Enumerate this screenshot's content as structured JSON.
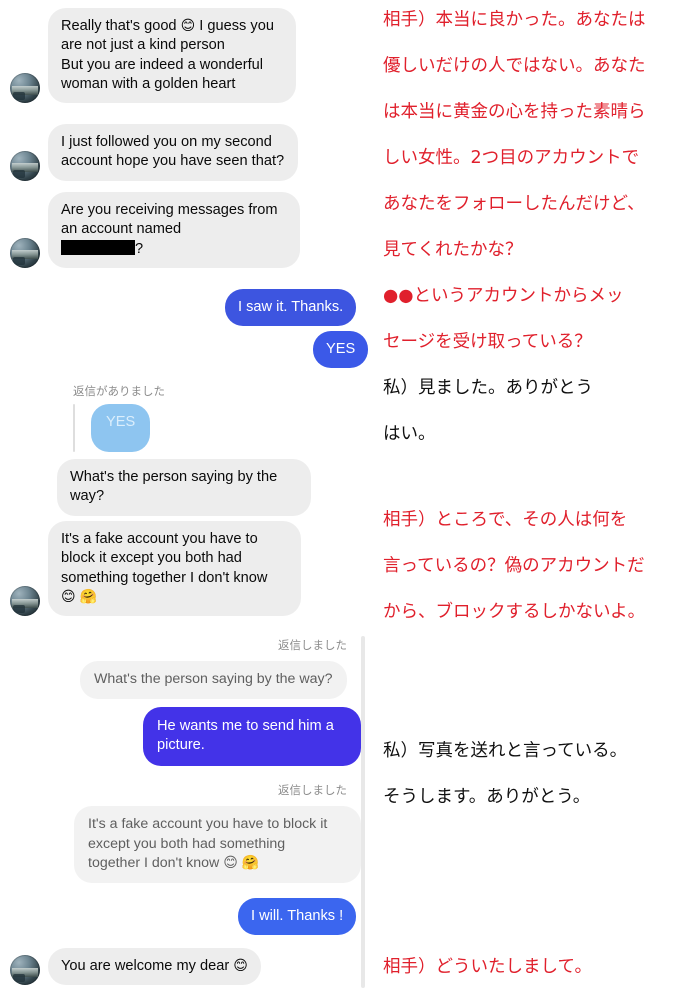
{
  "app": {
    "title": "Messenger conversation with Japanese translation",
    "accent_blue": "#3d55e0",
    "accent_indigo": "#4333e8",
    "bubble_gray": "#ededed",
    "translation_red": "#e0202c",
    "translation_black": "#101010"
  },
  "chat": {
    "messages": [
      {
        "id": "msg-1",
        "sender": "them",
        "text": "Really that's good 😊 I guess you are not just a kind person\nBut you are indeed a wonderful woman with a golden heart",
        "line1": "Really that's good",
        "emoji": "😊",
        "line1b": "I guess you",
        "line2": "are not just a kind person",
        "line3": "But you are indeed a wonderful",
        "line4": "woman with a golden heart",
        "has_avatar": true
      },
      {
        "id": "msg-2",
        "sender": "them",
        "text": "I just followed you on my second account hope you have seen that?",
        "has_avatar": true
      },
      {
        "id": "msg-3",
        "sender": "them",
        "text": "Are you receiving messages from an account named",
        "redacted": true,
        "trailing": "?",
        "has_avatar": true
      },
      {
        "id": "msg-4",
        "sender": "me",
        "text": "I saw it. Thanks."
      },
      {
        "id": "msg-5",
        "sender": "me",
        "text": "YES"
      },
      {
        "id": "reply-1",
        "type": "reply-notice",
        "label": "返信がありました",
        "quoted_text": "YES"
      },
      {
        "id": "msg-6",
        "sender": "them",
        "text": "What's the person saying by the way?"
      },
      {
        "id": "msg-7",
        "sender": "them",
        "line1": "It's a fake account you have to",
        "line2": "block it except you both had",
        "line3": "something together I don't know",
        "emoji1": "😊",
        "emoji2": "🤗",
        "has_avatar": true
      },
      {
        "id": "reply-2",
        "type": "reply-sent",
        "label": "返信しました",
        "quoted_text": "What's the person saying by the way?"
      },
      {
        "id": "msg-8",
        "sender": "me",
        "text": "He wants me to send him a picture."
      },
      {
        "id": "reply-3",
        "type": "reply-sent",
        "label": "返信しました",
        "q_line1": "It's a fake account you have to block it",
        "q_line2": "except you both had something",
        "q_line3": "together I don't know",
        "q_emoji1": "😊",
        "q_emoji2": "🤗"
      },
      {
        "id": "msg-9",
        "sender": "me",
        "text": "I will. Thanks !"
      },
      {
        "id": "msg-10",
        "sender": "them",
        "text": "You are welcome my dear",
        "emoji": "😊",
        "has_avatar": true
      }
    ]
  },
  "translation": {
    "lines": [
      {
        "id": "t1",
        "color": "red",
        "text": "相手）本当に良かった。あなたは"
      },
      {
        "id": "t2",
        "color": "red",
        "text": "優しいだけの人ではない。あなた"
      },
      {
        "id": "t3",
        "color": "red",
        "text": "は本当に黄金の心を持った素晴ら"
      },
      {
        "id": "t4",
        "color": "red",
        "text": "しい女性。2つ目のアカウントで"
      },
      {
        "id": "t5",
        "color": "red",
        "text": "あなたをフォローしたんだけど、"
      },
      {
        "id": "t6",
        "color": "red",
        "text": "見てくれたかな？"
      },
      {
        "id": "t7",
        "color": "red",
        "text": "●●というアカウントからメッ"
      },
      {
        "id": "t8",
        "color": "red",
        "text": "セージを受け取っている？"
      },
      {
        "id": "t9",
        "color": "black",
        "text": "私）見ました。ありがとう"
      },
      {
        "id": "t10",
        "color": "black",
        "text": "はい。"
      },
      {
        "id": "t11",
        "color": "red",
        "text": "相手）ところで、その人は何を"
      },
      {
        "id": "t12",
        "color": "red",
        "text": "言っているの？偽のアカウントだ"
      },
      {
        "id": "t13",
        "color": "red",
        "text": "から、ブロックするしかないよ。"
      },
      {
        "id": "t14",
        "color": "black",
        "text": "私）写真を送れと言っている。"
      },
      {
        "id": "t15",
        "color": "black",
        "text": "そうします。ありがとう。"
      },
      {
        "id": "t16",
        "color": "red",
        "text": "相手）どういたしまして。"
      }
    ]
  }
}
